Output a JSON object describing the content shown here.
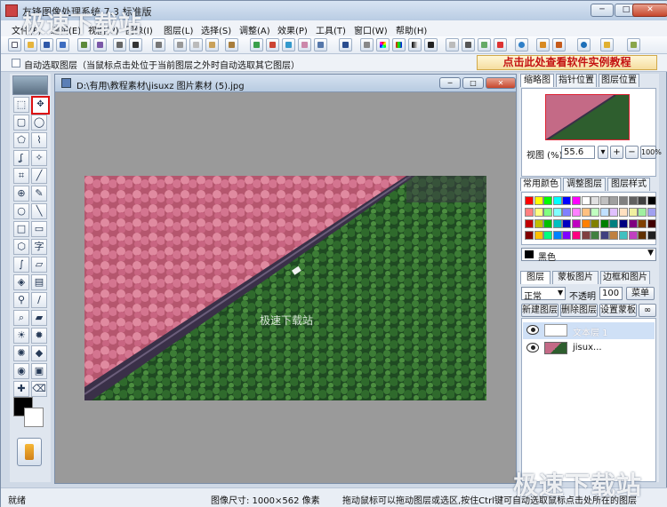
{
  "window": {
    "title": "友锋图像处理系统 7.3 标准版"
  },
  "menu": [
    "文件(F)",
    "编辑(E)",
    "视图(V)",
    "图像(I)",
    "图层(L)",
    "选择(S)",
    "调整(A)",
    "效果(P)",
    "工具(T)",
    "窗口(W)",
    "帮助(H)"
  ],
  "options": {
    "auto_select_label": "自动选取图层（当鼠标点击处位于当前图层之外时自动选取其它图层）",
    "promo": "点击此处查看软件实例教程"
  },
  "document": {
    "title": "D:\\有用\\教程素材\\jisuxz 图片素材 (5).jpg",
    "text_layer_content": "极速下载站"
  },
  "navigator": {
    "tabs": [
      "缩略图",
      "指针位置",
      "图层位置"
    ],
    "zoom_label": "视图 (%):",
    "zoom_value": "55.6",
    "zoom_in": "+",
    "zoom_out": "−",
    "zoom_100": "100%"
  },
  "colors": {
    "tabs": [
      "常用颜色",
      "调整图层",
      "图层样式"
    ],
    "selected_name": "黑色",
    "palette": [
      "#ff0000",
      "#ffff00",
      "#00ff00",
      "#00ffff",
      "#0000ff",
      "#ff00ff",
      "#ffffff",
      "#e0e0e0",
      "#c0c0c0",
      "#a0a0a0",
      "#808080",
      "#606060",
      "#404040",
      "#000000",
      "#ff8080",
      "#ffff80",
      "#80ff80",
      "#80ffff",
      "#8080ff",
      "#ff80ff",
      "#ffc080",
      "#c0ffc0",
      "#c0e0ff",
      "#e0c0ff",
      "#ffe0c0",
      "#f0f0a0",
      "#a0f0a0",
      "#a0a0f0",
      "#c00000",
      "#c0c000",
      "#00c000",
      "#00c0c0",
      "#0000c0",
      "#c000c0",
      "#ff8000",
      "#808000",
      "#008000",
      "#008080",
      "#000080",
      "#800080",
      "#804000",
      "#400000",
      "#800000",
      "#ffc000",
      "#00ff80",
      "#0080ff",
      "#8000ff",
      "#ff0080",
      "#804040",
      "#408040",
      "#404080",
      "#c08040",
      "#40c0c0",
      "#c040c0",
      "#603000",
      "#202020"
    ]
  },
  "layers": {
    "tabs": [
      "图层",
      "蒙板图片",
      "边框和图片"
    ],
    "blend_mode": "正常",
    "opacity_label": "不透明",
    "opacity_value": "100",
    "menu_button": "菜单",
    "new_layer": "新建图层",
    "delete_layer": "删除图层",
    "set_mask": "设置蒙板",
    "items": [
      {
        "name": "文本层 1",
        "type": "text"
      },
      {
        "name": "jisux...",
        "type": "image"
      }
    ]
  },
  "status": {
    "ready": "就绪",
    "image_size": "图像尺寸: 1000×562 像素",
    "hint": "拖动鼠标可以拖动图层或选区,按住Ctrl键可自动选取鼠标点击处所在的图层"
  },
  "watermarks": {
    "top_left": "极速下载站",
    "bottom_right": "极速下载站"
  }
}
